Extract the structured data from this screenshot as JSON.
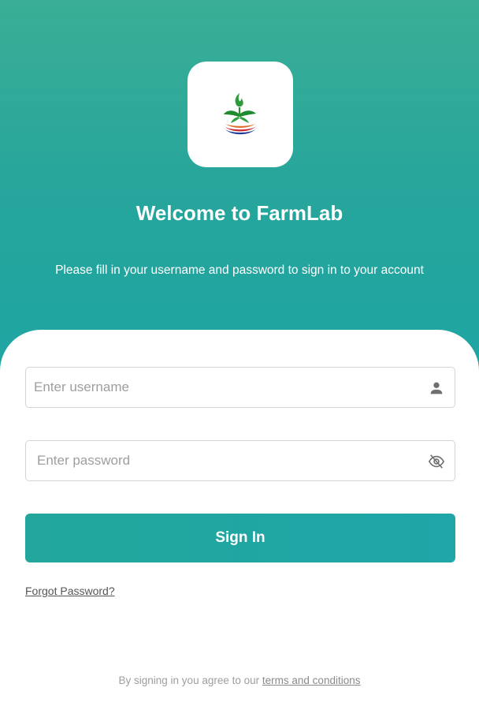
{
  "colors": {
    "brand_teal": "#25a59c",
    "card_background": "#ffffff",
    "placeholder_grey": "#9e9e9e"
  },
  "header": {
    "logo_icon": "farmlab-sprout-logo",
    "title": "Welcome to FarmLab",
    "subtitle": "Please fill in your username and password to sign in to your account"
  },
  "form": {
    "username_placeholder": "Enter username",
    "username_icon": "person-icon",
    "password_placeholder": "Enter password",
    "password_icon": "eye-off-icon",
    "signin_label": "Sign In",
    "forgot_label": "Forgot Password?"
  },
  "footer": {
    "terms_prefix": "By signing in you agree to our",
    "terms_link": "terms and conditions"
  }
}
